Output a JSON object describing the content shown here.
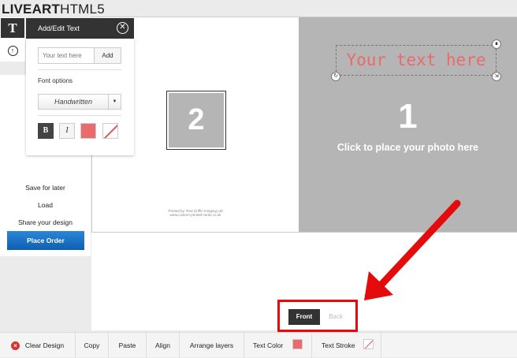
{
  "app": {
    "logo_bold": "LIVEART",
    "logo_light": "HTML5"
  },
  "tools": {
    "text_icon": "T",
    "upload_icon": "upload-icon"
  },
  "panel": {
    "title": "Add/Edit Text",
    "close_icon": "close-icon",
    "input_placeholder": "Your text here",
    "add_label": "Add",
    "font_options_label": "Font options",
    "font_value": "Handwritten",
    "bold_label": "B",
    "italic_label": "I",
    "text_color": "#ea6b6b"
  },
  "side_menu": {
    "save_later": "Save for later",
    "load": "Load",
    "share": "Share your design",
    "place_order": "Place Order"
  },
  "card": {
    "inside_number": "2",
    "printed_by_line1": "Printed by: Red Griffin Imaging Ltd",
    "printed_by_line2": "www.custom-printed-cards.co.uk",
    "front_number": "1",
    "front_caption": "Click to place your photo here",
    "text_object": "Your text here",
    "text_object_color": "#ea6b6b"
  },
  "side_nav": {
    "front": "Front",
    "back": "Back"
  },
  "toolbar": {
    "clear": "Clear Design",
    "copy": "Copy",
    "paste": "Paste",
    "align": "Align",
    "arrange": "Arrange layers",
    "text_color": "Text Color",
    "text_stroke": "Text Stroke",
    "text_color_value": "#ea6b6b"
  },
  "annotation": {
    "color": "#e30b0b"
  }
}
